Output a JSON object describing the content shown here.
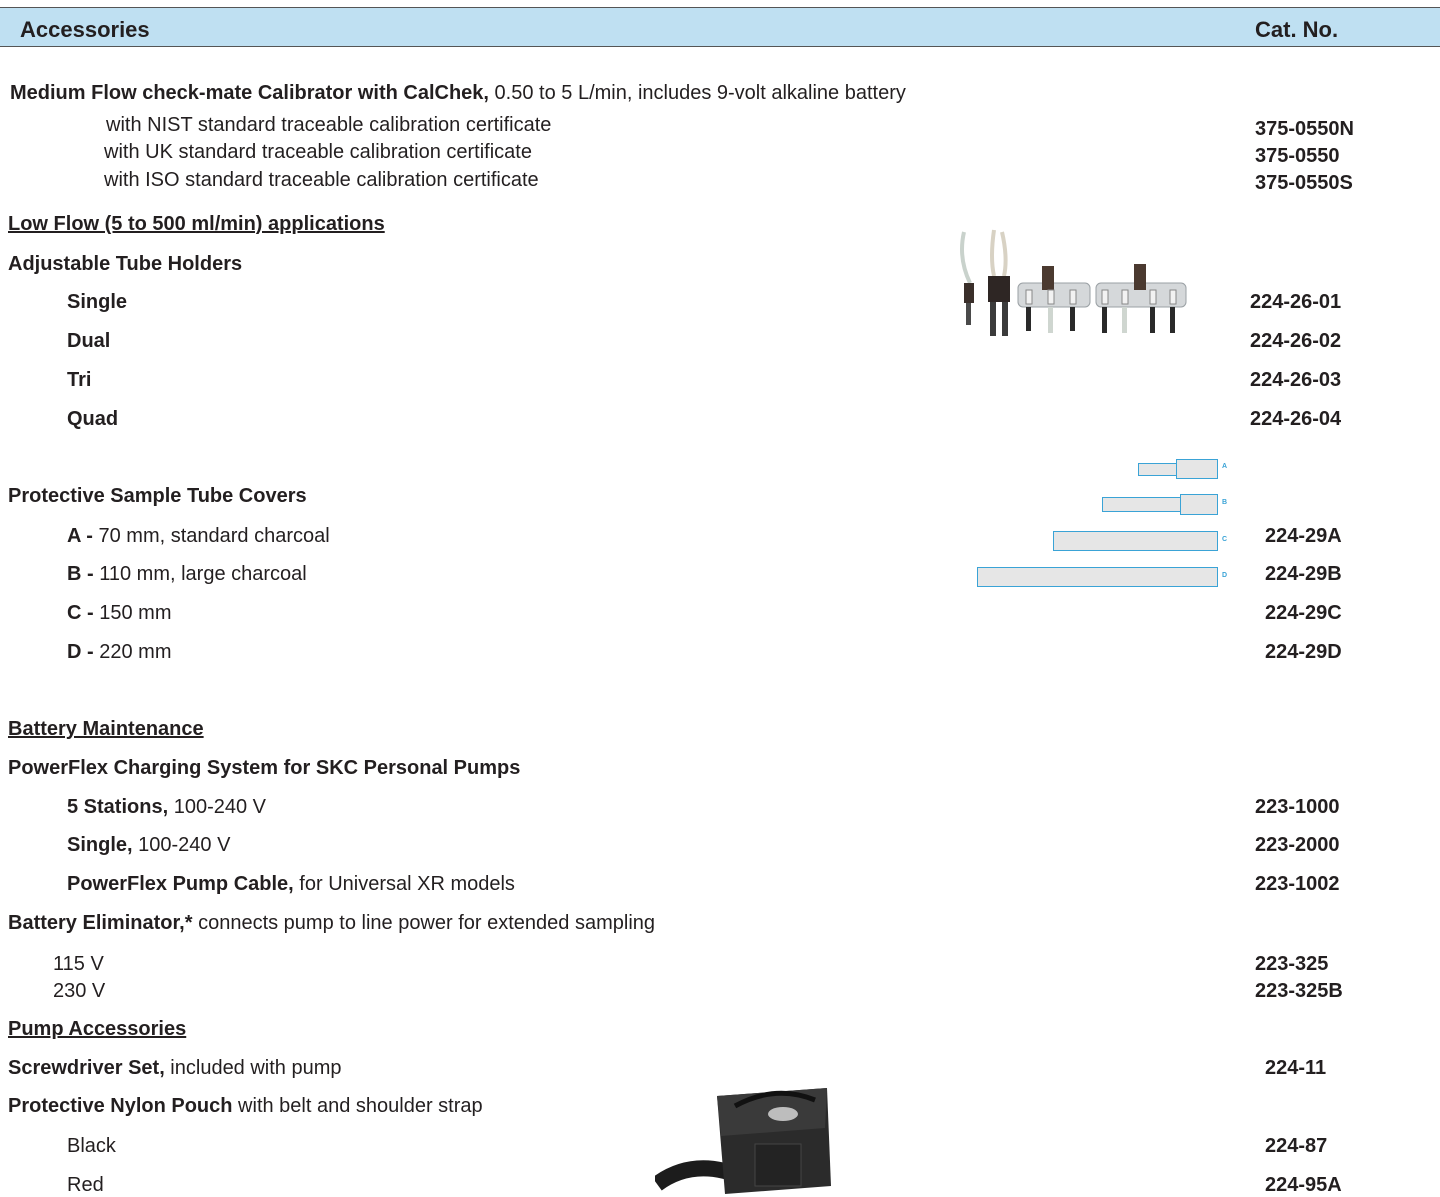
{
  "header": {
    "title": "Accessories",
    "cat_label": "Cat. No."
  },
  "calibrator": {
    "name": "Medium Flow check-mate Calibrator with CalChek,",
    "desc": " 0.50 to 5 L/min, includes 9-volt alkaline battery",
    "options": [
      {
        "label": "with NIST standard traceable calibration certificate",
        "cat": "375-0550N"
      },
      {
        "label": "with UK standard traceable calibration certificate",
        "cat": "375-0550"
      },
      {
        "label": "with ISO standard traceable calibration certificate",
        "cat": "375-0550S"
      }
    ]
  },
  "low_flow": {
    "heading": "Low Flow (5 to 500 ml/min) applications",
    "holders_title": "Adjustable Tube Holders",
    "holders": [
      {
        "label": "Single",
        "cat": "224-26-01"
      },
      {
        "label": "Dual",
        "cat": "224-26-02"
      },
      {
        "label": "Tri",
        "cat": "224-26-03"
      },
      {
        "label": "Quad",
        "cat": "224-26-04"
      }
    ],
    "covers_title": "Protective Sample Tube Covers",
    "covers": [
      {
        "code": "A -",
        "desc": " 70 mm, standard charcoal",
        "cat": "224-29A"
      },
      {
        "code": "B -",
        "desc": " 110 mm, large charcoal",
        "cat": "224-29B"
      },
      {
        "code": "C -",
        "desc": " 150 mm",
        "cat": "224-29C"
      },
      {
        "code": "D -",
        "desc": " 220 mm",
        "cat": "224-29D"
      }
    ],
    "tube_letters": [
      "A",
      "B",
      "C",
      "D"
    ]
  },
  "battery": {
    "heading": "Battery Maintenance",
    "powerflex_title": "PowerFlex Charging System for SKC Personal Pumps",
    "powerflex": [
      {
        "name": "5 Stations,",
        "desc": " 100-240 V",
        "cat": "223-1000"
      },
      {
        "name": "Single,",
        "desc": " 100-240 V",
        "cat": "223-2000"
      },
      {
        "name": "PowerFlex Pump Cable,",
        "desc": " for Universal XR models",
        "cat": "223-1002"
      }
    ],
    "eliminator_name": "Battery Eliminator,*",
    "eliminator_desc": " connects pump to line power for extended sampling",
    "eliminator": [
      {
        "label": "115 V",
        "cat": "223-325"
      },
      {
        "label": "230 V",
        "cat": "223-325B"
      }
    ]
  },
  "pump_acc": {
    "heading": "Pump Accessories",
    "screwdriver_name": "Screwdriver Set,",
    "screwdriver_desc": " included with pump",
    "screwdriver_cat": "224-11",
    "pouch_name": "Protective Nylon Pouch",
    "pouch_desc": " with belt and shoulder strap",
    "pouches": [
      {
        "label": "Black",
        "cat": "224-87"
      },
      {
        "label": "Red",
        "cat": "224-95A"
      }
    ]
  },
  "colors": {
    "header_bg": "#bfe0f2",
    "tube_outline": "#3aa3d6",
    "text": "#231f20"
  }
}
